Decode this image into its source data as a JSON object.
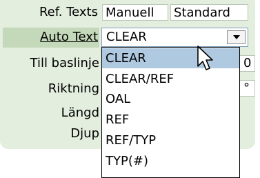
{
  "ref_texts": {
    "label": "Ref. Texts",
    "manuell": "Manuell",
    "standard": "Standard"
  },
  "auto_text": {
    "label": "Auto Text",
    "value": "CLEAR"
  },
  "fields": [
    {
      "label": "Till baslinje",
      "value": "0"
    },
    {
      "label": "Riktning",
      "value": "°"
    },
    {
      "label": "Längd"
    },
    {
      "label": "Djup"
    }
  ],
  "dropdown": {
    "options": [
      "CLEAR",
      "CLEAR/REF",
      "OAL",
      "REF",
      "REF/TYP",
      "TYP(#)"
    ],
    "highlighted": "CLEAR"
  },
  "colors": {
    "panel": "#e3eedf",
    "highlight_row": "#c4d9b9",
    "selected_option": "#aec9e0"
  },
  "icons": {
    "combo_arrow": "chevron-down-icon",
    "pointer": "mouse-cursor-icon"
  }
}
